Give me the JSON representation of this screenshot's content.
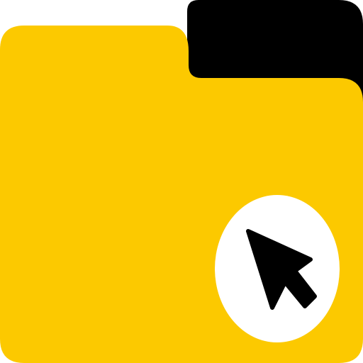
{
  "icon": {
    "name": "folder-cursor-icon",
    "parts": {
      "folder": "folder-icon",
      "back_tab": "folder-back-tab",
      "badge": "cursor-badge",
      "cursor": "cursor-arrow-icon"
    }
  },
  "colors": {
    "folder_fill": "#FCC900",
    "back_tab_fill": "#000000",
    "badge_fill": "#FFFFFF",
    "cursor_fill": "#000000",
    "background": "#FFFFFF"
  }
}
